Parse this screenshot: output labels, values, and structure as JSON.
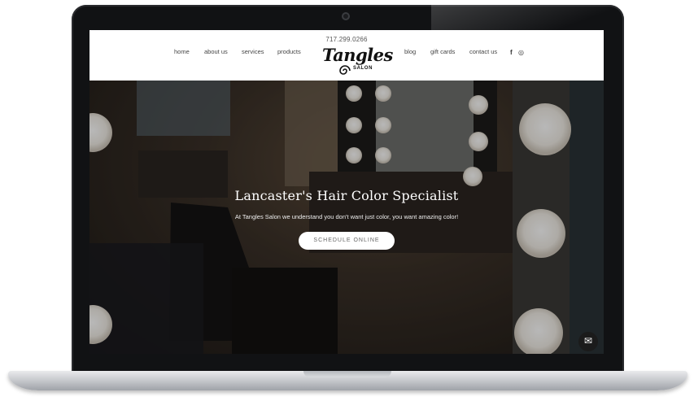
{
  "site": {
    "phone": "717.299.0266",
    "nav_left": [
      "home",
      "about us",
      "services",
      "products"
    ],
    "nav_right": [
      "blog",
      "gift cards",
      "contact us"
    ],
    "logo_main": "Tangles",
    "logo_sub": "SALON",
    "social_icons": [
      "facebook-icon",
      "instagram-icon"
    ]
  },
  "hero": {
    "title": "Lancaster's Hair Color Specialist",
    "subtitle": "At Tangles Salon we understand you don't want just color, you want amazing color!",
    "cta_label": "SCHEDULE ONLINE"
  },
  "icons": {
    "mail": "✉",
    "facebook": "f",
    "instagram": "◎"
  },
  "colors": {
    "header_bg": "#ffffff",
    "hero_text": "#ffffff",
    "laptop_bezel": "#111214"
  }
}
